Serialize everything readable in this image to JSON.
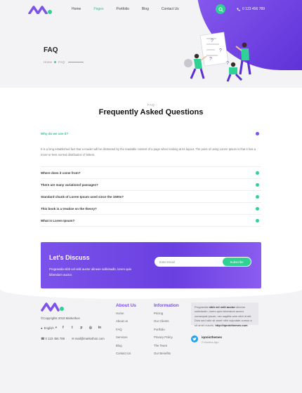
{
  "nav": {
    "items": [
      "Home",
      "Pages",
      "Portfolio",
      "Blog",
      "Contact Us"
    ],
    "active_index": 1,
    "phone": "0 123 456 789"
  },
  "colors": {
    "accent_green": "#2fd194",
    "accent_purple": "#7b52ea",
    "hero_bg": "#f3f3f5"
  },
  "hero": {
    "title": "FAQ",
    "breadcrumb": [
      "Home",
      "FAQ"
    ]
  },
  "faq": {
    "eyebrow": "FAQ",
    "heading": "Frequently Asked Questions",
    "items": [
      {
        "question": "Why do we use it?",
        "open": true,
        "answer": "It is a long established fact that a reader will be distracted by the readable content of a page when looking at its layout. The point of using Lorem Ipsum is that it has a more-or-less normal distribution of letters."
      },
      {
        "question": "Where does it come from?",
        "open": false
      },
      {
        "question": "There are many variationsf passages?",
        "open": false
      },
      {
        "question": "Standard chunk of Lorem Ipsum used since the 1500s?",
        "open": false
      },
      {
        "question": "This book is a treatise on the theory?",
        "open": false
      },
      {
        "question": "What is Lorem Ipsum?",
        "open": false
      }
    ]
  },
  "cta": {
    "title": "Let's Discuss",
    "text": "Progravida nibh vel velit auctor alinean sollicitudin, lorem quis bibendum auctor.",
    "email_placeholder": "Enter Email",
    "button": "Subscribe"
  },
  "footer": {
    "copyright": "©Copyrights 2018 Markethon",
    "language": "English",
    "social_icons": [
      "facebook-icon",
      "twitter-icon",
      "pinterest-icon",
      "instagram-icon",
      "linkedin-icon"
    ],
    "phone": "0 123 456 789",
    "email": "mail@markethon.com",
    "about": {
      "title": "About Us",
      "links": [
        "Home",
        "About us",
        "FAQ",
        "Services",
        "Blog",
        "Contact Us"
      ]
    },
    "information": {
      "title": "Information",
      "links": [
        "Pricing",
        "Our Clients",
        "Portfolio",
        "Privacy Policy",
        "The Team",
        "Our Benefits"
      ]
    },
    "tweet": {
      "pre": "Progravida",
      "bold": "nibh vel velit auctor",
      "post": "alinean sollicitudin, lorem quis bibendum auctor consequat ipsum, nec sagittis sem nibh id elit. Duis sed odio sit amet nibh vulputate cursus a sit amet mauris.",
      "link": "http://iqonicthemes.com",
      "handle": "iqonicthemes",
      "time": "2 Months Ago"
    }
  }
}
